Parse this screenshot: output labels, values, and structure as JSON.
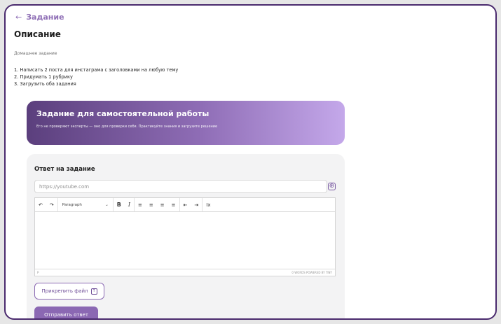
{
  "header": {
    "back_arrow": "←",
    "back_label": "Задание"
  },
  "description": {
    "title": "Описание",
    "subtitle": "Домашнее задание",
    "items": [
      "1. Написать 2 поста для инстаграма с заголовками на любую тему",
      "2. Придумать 1 рубрику",
      "3. Загрузить оба задания"
    ]
  },
  "banner": {
    "title": "Задание для самостоятельной работы",
    "subtitle": "Его не проверяют эксперты — оно для проверки себя. Практикуйте знания и загрузите решение"
  },
  "answer": {
    "title": "Ответ на задание",
    "url_placeholder": "https://youtube.com",
    "add_icon": "⊕",
    "toolbar": {
      "undo": "↶",
      "redo": "↷",
      "paragraph": "Paragraph",
      "chevron": "⌄",
      "bold": "B",
      "italic": "I",
      "align_left": "≡",
      "align_center": "≡",
      "align_right": "≡",
      "align_justify": "≡",
      "outdent": "⇤",
      "indent": "⇥",
      "clear_format": "Ix"
    },
    "status_left": "P",
    "status_right": "0 WORDS  POWERED BY TINY",
    "attach_label": "Прикрепить файл",
    "attach_icon": "↑",
    "send_label": "Отправить ответ"
  },
  "colors": {
    "accent": "#8b68b3",
    "frame": "#4a2a6e"
  }
}
